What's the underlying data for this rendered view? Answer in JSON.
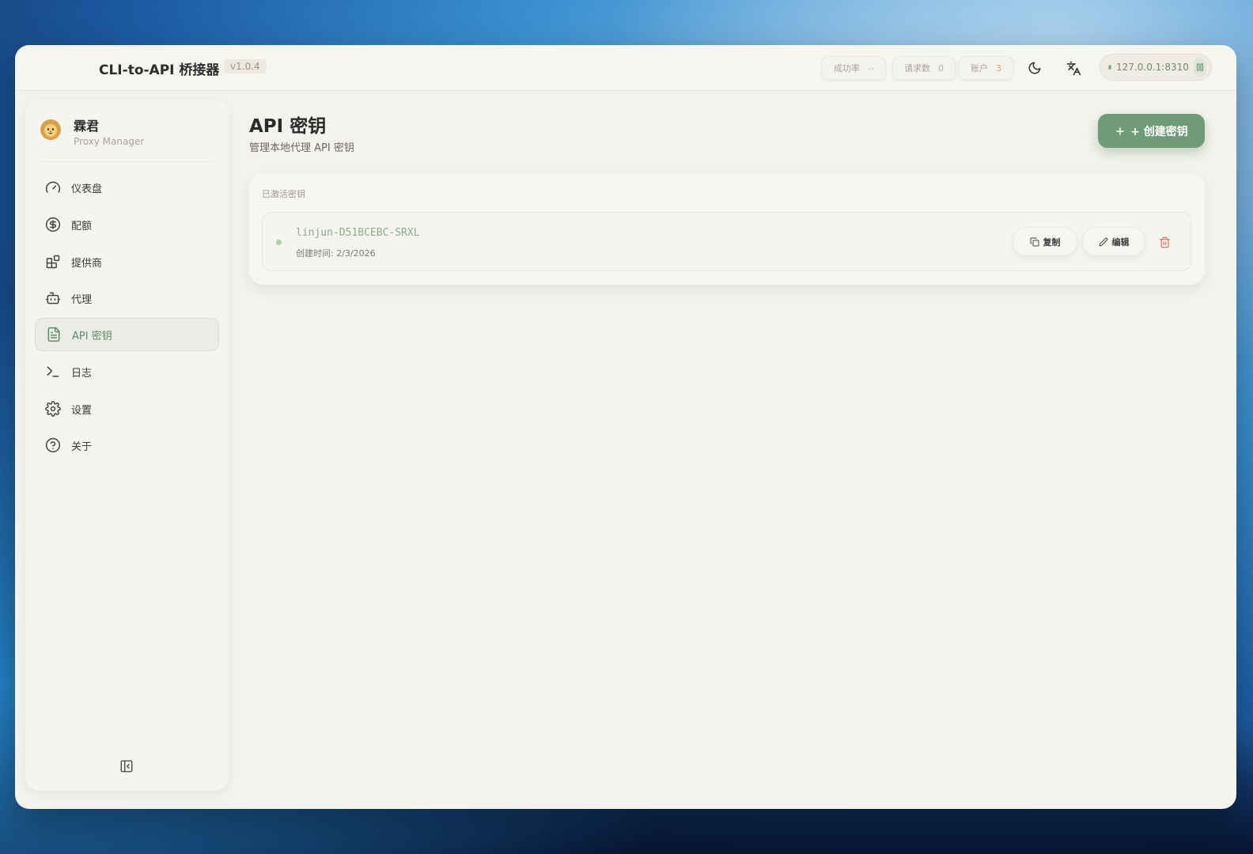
{
  "app": {
    "title": "CLI-to-API 桥接器",
    "version": "v1.0.4"
  },
  "header": {
    "stats": [
      {
        "label": "成功率",
        "value": "--"
      },
      {
        "label": "请求数",
        "value": "0"
      },
      {
        "label": "账户",
        "value": "3"
      }
    ],
    "theme_icon": "moon-icon",
    "language_icon": "translate-icon",
    "server_address": "127.0.0.1:8310",
    "server_status_color": "#7fb08a"
  },
  "sidebar": {
    "brand_name": "霖君",
    "brand_sub": "Proxy Manager",
    "items": [
      {
        "label": "仪表盘",
        "icon": "gauge-icon"
      },
      {
        "label": "配额",
        "icon": "dollar-circle-icon"
      },
      {
        "label": "提供商",
        "icon": "blocks-icon"
      },
      {
        "label": "代理",
        "icon": "bot-icon"
      },
      {
        "label": "API 密钥",
        "icon": "file-text-icon",
        "active": true
      },
      {
        "label": "日志",
        "icon": "terminal-icon"
      },
      {
        "label": "设置",
        "icon": "gear-icon"
      },
      {
        "label": "关于",
        "icon": "help-circle-icon"
      }
    ],
    "collapse_icon": "panel-collapse-icon"
  },
  "main": {
    "title": "API 密钥",
    "subtitle": "管理本地代理 API 密钥",
    "create_button": "+ 创建密钥",
    "section_label": "已激活密钥",
    "keys": [
      {
        "name": "linjun-D51BCEBC-SRXL",
        "created": "创建时间: 2/3/2026",
        "copy_label": "复制",
        "edit_label": "编辑"
      }
    ]
  },
  "colors": {
    "accent": "#6f9b77",
    "active_nav_text": "#5f8b68",
    "danger": "#e07070",
    "accounts_value": "#e2a46a"
  }
}
